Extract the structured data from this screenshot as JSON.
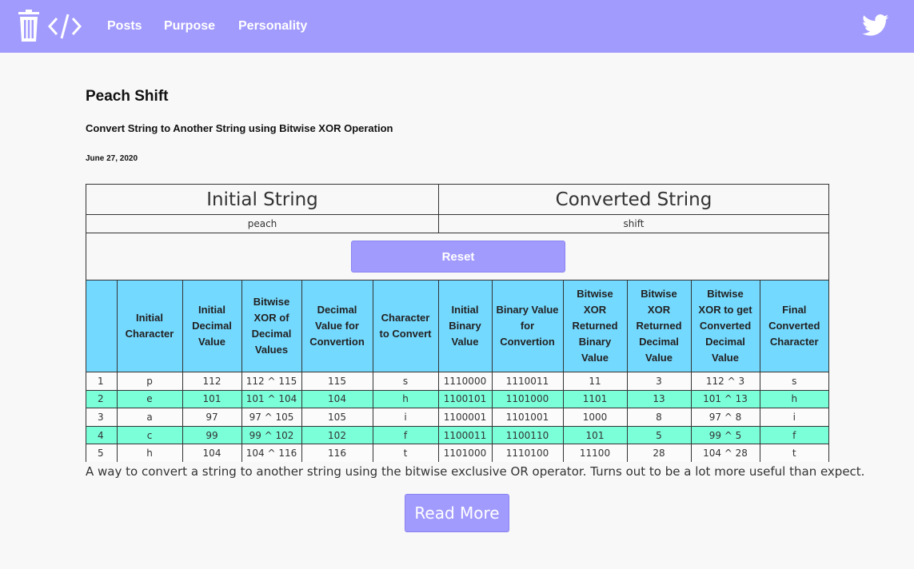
{
  "nav": {
    "links": [
      "Posts",
      "Purpose",
      "Personality"
    ],
    "logo_icons": [
      "trash-icon",
      "code-icon"
    ],
    "social_icon": "twitter-icon"
  },
  "post": {
    "title": "Peach Shift",
    "subtitle": "Convert String to Another String using Bitwise XOR Operation",
    "date": "June 27, 2020",
    "description": "A way to convert a string to another string using the bitwise exclusive OR operator. Turns out to be a lot more useful than expect.",
    "read_more_label": "Read More"
  },
  "widget": {
    "initial_header": "Initial String",
    "converted_header": "Converted String",
    "initial_value": "peach",
    "converted_value": "shift",
    "reset_label": "Reset",
    "columns": [
      "",
      "Initial Character",
      "Initial Decimal Value",
      "Bitwise XOR of Decimal Values",
      "Decimal Value for Convertion",
      "Character to Convert",
      "Initial Binary Value",
      "Binary Value for Convertion",
      "Bitwise XOR Returned Binary Value",
      "Bitwise XOR Returned Decimal Value",
      "Bitwise XOR to get Converted Decimal Value",
      "Final Converted Character"
    ],
    "rows": [
      [
        "1",
        "p",
        "112",
        "112 ^ 115",
        "115",
        "s",
        "1110000",
        "1110011",
        "11",
        "3",
        "112 ^ 3",
        "s"
      ],
      [
        "2",
        "e",
        "101",
        "101 ^ 104",
        "104",
        "h",
        "1100101",
        "1101000",
        "1101",
        "13",
        "101 ^ 13",
        "h"
      ],
      [
        "3",
        "a",
        "97",
        "97 ^ 105",
        "105",
        "i",
        "1100001",
        "1101001",
        "1000",
        "8",
        "97 ^ 8",
        "i"
      ],
      [
        "4",
        "c",
        "99",
        "99 ^ 102",
        "102",
        "f",
        "1100011",
        "1100110",
        "101",
        "5",
        "99 ^ 5",
        "f"
      ],
      [
        "5",
        "h",
        "104",
        "104 ^ 116",
        "116",
        "t",
        "1101000",
        "1110100",
        "11100",
        "28",
        "104 ^ 28",
        "t"
      ]
    ]
  },
  "colors": {
    "accent": "#a29bfe",
    "table_header": "#74d9ff",
    "row_highlight": "#7bffd9",
    "background": "#f8f8f8"
  }
}
